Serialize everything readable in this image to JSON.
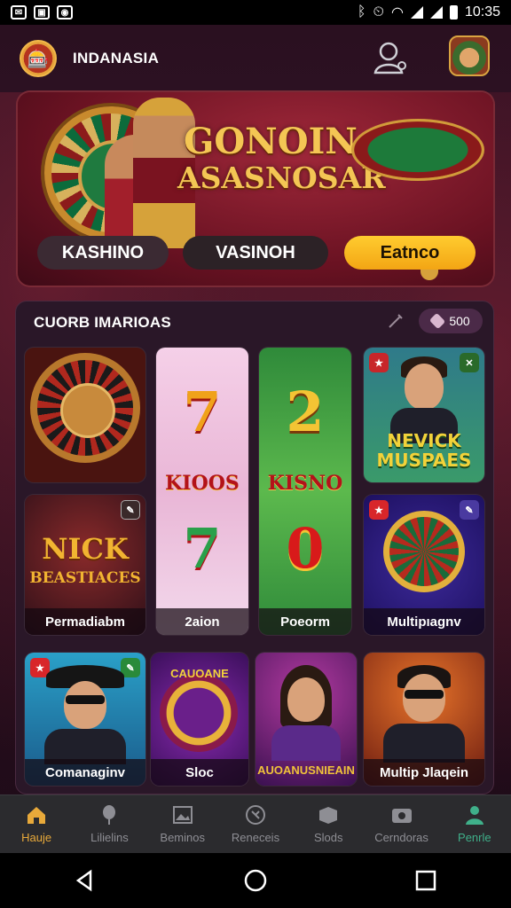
{
  "status_bar": {
    "time": "10:35",
    "left_icons": [
      "mail-icon",
      "photo-icon",
      "chat-icon"
    ],
    "right_icons": [
      "bluetooth-icon",
      "alarm-icon",
      "wifi-icon",
      "signal-icon",
      "signal-icon",
      "battery-icon"
    ]
  },
  "header": {
    "app_name": "INDANASIA"
  },
  "banner": {
    "title_line1": "GONOIN",
    "title_line2": "ASASNOSAR",
    "buttons": [
      "KASHINO",
      "VASINOH",
      "Eatnco"
    ]
  },
  "games": {
    "section_title": "CUORB IMARIOAS",
    "badge_value": "500",
    "tiles": [
      {
        "caption": ""
      },
      {
        "caption": "2aion",
        "num_top": "7",
        "word": "KIOOS",
        "num_bottom": "7"
      },
      {
        "caption": "Poeorm",
        "num_top": "2",
        "word": "KISNO",
        "num_bottom": "0"
      },
      {
        "caption": "",
        "logo_line1": "NEVICK",
        "logo_line2": "MUSPAES"
      },
      {
        "caption": "Permadiabm",
        "logo_line1": "NICK",
        "logo_line2": "BEASTIACES"
      },
      {
        "caption": "Multipıagnv"
      },
      {
        "caption": "Comanaginv"
      },
      {
        "caption": "Sloc",
        "logo": "CAUOANE"
      },
      {
        "caption": "",
        "logo": "AUOANUSNIEAIN"
      },
      {
        "caption": "Multip Jlaqein"
      }
    ]
  },
  "bottom_nav": {
    "items": [
      {
        "label": "Hauje",
        "icon": "home-icon"
      },
      {
        "label": "Lilielins",
        "icon": "balloon-icon"
      },
      {
        "label": "Beminos",
        "icon": "image-icon"
      },
      {
        "label": "Reneceis",
        "icon": "target-icon"
      },
      {
        "label": "Slods",
        "icon": "box-icon"
      },
      {
        "label": "Cerndoras",
        "icon": "camera-icon"
      },
      {
        "label": "Penrle",
        "icon": "person-icon"
      }
    ]
  },
  "colors": {
    "accent_gold": "#f3a514",
    "background": "#2a0f1e",
    "active_nav": "#e8a93a",
    "profile_nav": "#3fb08a"
  }
}
